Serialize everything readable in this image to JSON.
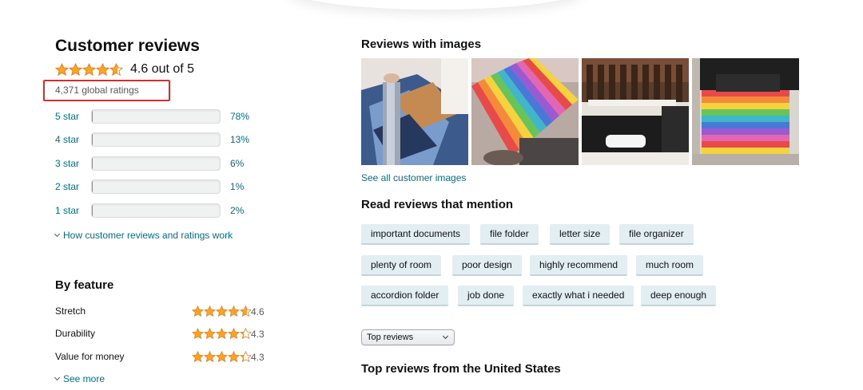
{
  "reviews": {
    "title": "Customer reviews",
    "average": 4.6,
    "overall_text": "4.6 out of 5",
    "global_ratings": "4,371 global ratings",
    "star_color": "#ffa41c",
    "highlight_color": "#d62d2d",
    "histogram": [
      {
        "label": "5 star",
        "percent": 78,
        "percent_text": "78%"
      },
      {
        "label": "4 star",
        "percent": 13,
        "percent_text": "13%"
      },
      {
        "label": "3 star",
        "percent": 6,
        "percent_text": "6%"
      },
      {
        "label": "2 star",
        "percent": 1,
        "percent_text": "1%"
      },
      {
        "label": "1 star",
        "percent": 2,
        "percent_text": "2%"
      }
    ],
    "how_link": "How customer reviews and ratings work"
  },
  "features": {
    "title": "By feature",
    "items": [
      {
        "name": "Stretch",
        "rating": 4.6,
        "rating_text": "4.6"
      },
      {
        "name": "Durability",
        "rating": 4.3,
        "rating_text": "4.3"
      },
      {
        "name": "Value for money",
        "rating": 4.3,
        "rating_text": "4.3"
      }
    ],
    "see_more": "See more"
  },
  "images_section": {
    "title": "Reviews with images",
    "see_all": "See all customer images",
    "images": [
      {
        "icon": "accordion-file-photo"
      },
      {
        "icon": "rainbow-file-photo"
      },
      {
        "icon": "desk-file-photo"
      },
      {
        "icon": "expanding-file-photo"
      }
    ]
  },
  "mentions": {
    "title": "Read reviews that mention",
    "chips": [
      "important documents",
      "file folder",
      "letter size",
      "file organizer",
      "plenty of room",
      "poor design",
      "highly recommend",
      "much room",
      "accordion folder",
      "job done",
      "exactly what i needed",
      "deep enough"
    ]
  },
  "sort": {
    "selected": "Top reviews"
  },
  "top_reviews_title": "Top reviews from the United States"
}
